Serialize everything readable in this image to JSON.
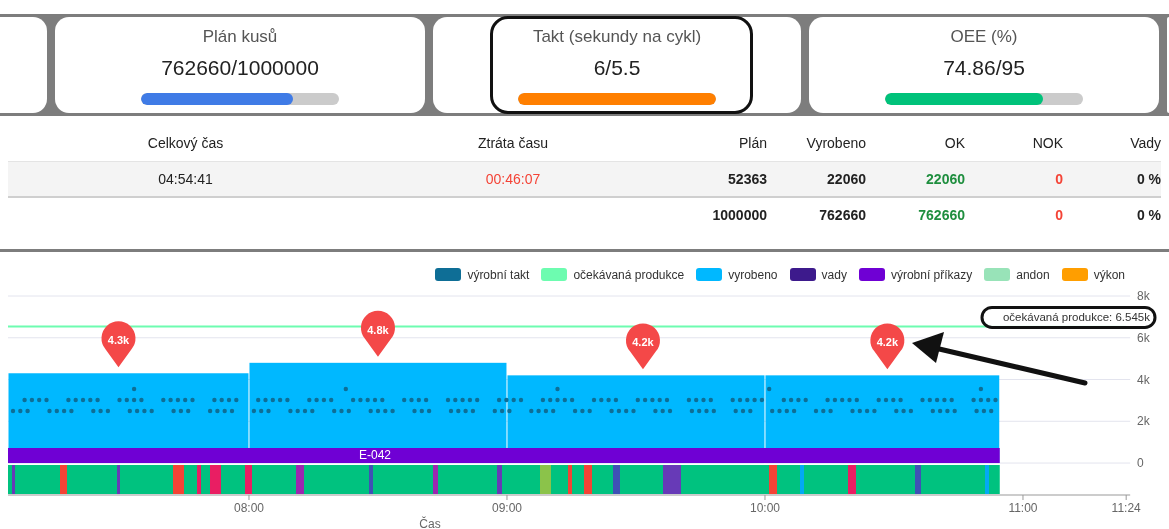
{
  "kpis": [
    {
      "title": "Plán kusů",
      "value": "762660/1000000",
      "level": 0.77,
      "color": "#3f7be6",
      "highlighted": false
    },
    {
      "title": "Takt (sekundy na cykl)",
      "value": "6/5.5",
      "level": 1,
      "color": "#ff7f00",
      "highlighted": true
    },
    {
      "title": "OEE (%)",
      "value": "74.86/95",
      "level": 0.8,
      "color": "#00c27a",
      "highlighted": false
    }
  ],
  "table": {
    "columns": [
      {
        "label": "Celkový čas",
        "kind": "time"
      },
      {
        "label": "Ztráta času",
        "kind": "loss"
      },
      {
        "label": "Plán",
        "kind": "number"
      },
      {
        "label": "Vyrobeno",
        "kind": "number"
      },
      {
        "label": "OK",
        "kind": "ok"
      },
      {
        "label": "NOK",
        "kind": "nok"
      },
      {
        "label": "Vady",
        "kind": "number"
      }
    ],
    "rows": [
      {
        "kind": "detail",
        "cells": [
          "04:54:41",
          "00:46:07",
          "52363",
          "22060",
          "22060",
          "0",
          "0 %"
        ]
      },
      {
        "kind": "total",
        "cells": [
          "",
          "",
          "1000000",
          "762660",
          "762660",
          "0",
          "0 %"
        ]
      }
    ]
  },
  "chart": {
    "legend": [
      {
        "label": "výrobní takt",
        "color": "#0e6e96"
      },
      {
        "label": "očekávaná produkce",
        "color": "#6dfcb0"
      },
      {
        "kind": "series"
      },
      {
        "label": "vady",
        "color": "#3d1a8c"
      },
      {
        "label": "výrobní příkazy",
        "color": "#6f00d4"
      },
      {
        "label": "andon",
        "color": "#98e3b8"
      },
      {
        "label": "výkon",
        "color": "#ff9e00"
      }
    ],
    "order_label": "E-042",
    "chart_data": {
      "type": "bar",
      "xlabel": "Čas",
      "x": [
        7.533,
        8.5,
        9.5,
        10.455
      ],
      "xlim": [
        7.066,
        11.4
      ],
      "ylim": [
        -1530,
        8000
      ],
      "grid": true,
      "xticks": [
        {
          "value": 8,
          "label": "08:00"
        },
        {
          "value": 9,
          "label": "09:00"
        },
        {
          "value": 10,
          "label": "10:00"
        },
        {
          "value": 11,
          "label": "11:00"
        },
        {
          "value": 11.4,
          "label": "11:24"
        }
      ],
      "yticks": [
        {
          "value": 0,
          "label": "0"
        },
        {
          "value": 2000,
          "label": "2k"
        },
        {
          "value": 4000,
          "label": "4k"
        },
        {
          "value": 6000,
          "label": "6k"
        },
        {
          "value": 8000,
          "label": "8k"
        }
      ],
      "series": [
        {
          "name": "vyrobeno",
          "color": "#00b8ff",
          "values": [
            4300,
            4800,
            4200,
            4200
          ]
        }
      ],
      "value_labels": [
        "4.3k",
        "4.8k",
        "4.2k",
        "4.2k"
      ],
      "ref_lines": [
        {
          "axis": "y",
          "value": 6545,
          "label": "očekávaná produkce: 6.545k",
          "color": "#6dfcb0"
        }
      ]
    }
  }
}
